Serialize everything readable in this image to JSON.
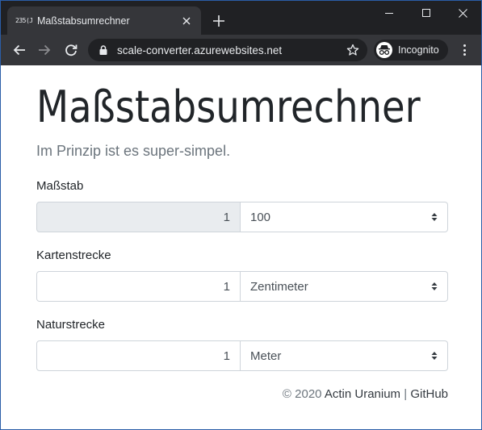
{
  "browser": {
    "tab_title": "Maßstabsumrechner",
    "favicon_text": "235(J",
    "url": "scale-converter.azurewebsites.net",
    "incognito_label": "Incognito"
  },
  "page": {
    "title": "Maßstabsumrechner",
    "lead": "Im Prinzip ist es super-simpel.",
    "fields": [
      {
        "label": "Maßstab",
        "value": "1",
        "unit": "100",
        "readonly": true
      },
      {
        "label": "Kartenstrecke",
        "value": "1",
        "unit": "Zentimeter",
        "readonly": false
      },
      {
        "label": "Naturstrecke",
        "value": "1",
        "unit": "Meter",
        "readonly": false
      }
    ],
    "footer": {
      "copyright": "© 2020",
      "author_link": "Actin Uranium",
      "separator": "|",
      "github_link": "GitHub"
    }
  },
  "colors": {
    "tabstrip_bg": "#202124",
    "toolbar_bg": "#35363a",
    "text_primary": "#212529",
    "text_muted": "#6c757d",
    "input_border": "#ced4da",
    "readonly_bg": "#e9ecef"
  }
}
